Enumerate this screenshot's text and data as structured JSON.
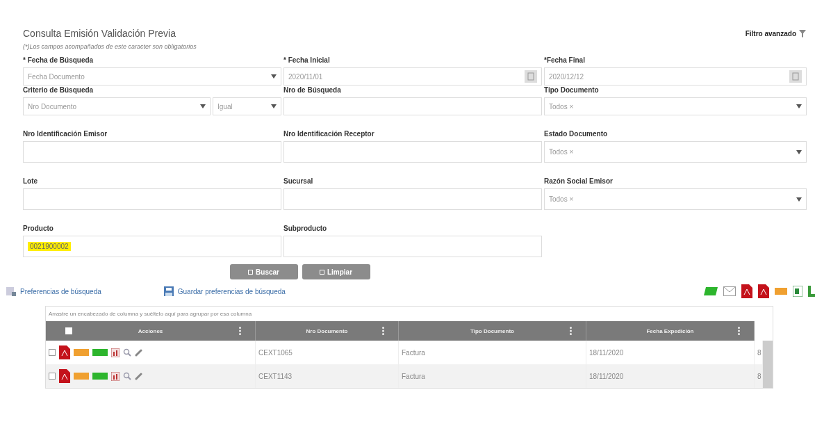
{
  "header": {
    "title": "Consulta Emisión Validación Previa",
    "note": "(*)Los campos acompañados de este caracter son obligatorios",
    "advanced_filter": "Filtro avanzado"
  },
  "field_rows": [
    [
      {
        "label": "* Fecha de Búsqueda",
        "kind": "select",
        "value": "Fecha Documento"
      },
      {
        "label": "* Fecha Inicial",
        "kind": "date",
        "value": "2020/11/01"
      },
      {
        "label": "*Fecha Final",
        "kind": "date",
        "value": "2020/12/12"
      }
    ],
    [
      {
        "label": "Criterio de Búsqueda",
        "kind": "dual_select",
        "values": [
          "Nro Documento",
          "Igual"
        ]
      },
      {
        "label": "Nro de Búsqueda",
        "kind": "text"
      },
      {
        "label": "Tipo Documento",
        "kind": "multiselect",
        "tag": "Todos ×"
      }
    ],
    [
      {
        "label": "Nro Identificación Emisor",
        "kind": "text"
      },
      {
        "label": "Nro Identificación Receptor",
        "kind": "text"
      },
      {
        "label": "Estado Documento",
        "kind": "multiselect",
        "tag": "Todos ×"
      }
    ],
    [
      {
        "label": "Lote",
        "kind": "text"
      },
      {
        "label": "Sucursal",
        "kind": "text"
      },
      {
        "label": "Razón Social Emisor",
        "kind": "multiselect",
        "tag": "Todos ×"
      }
    ],
    [
      {
        "label": "Producto",
        "kind": "text",
        "value": "0021900002",
        "highlighted": true
      },
      {
        "label": "Subproducto",
        "kind": "text"
      }
    ]
  ],
  "buttons": [
    "Buscar",
    "Limpiar"
  ],
  "links": [
    "Preferencias de búsqueda",
    "Guardar preferencias de búsqueda"
  ],
  "table": {
    "group_hint": "Arrastre un encabezado de columna y suéltelo aquí para agrupar por esa columna",
    "header_checked": false,
    "columns": [
      "Acciones",
      "Nro Documento",
      "Tipo Documento",
      "Fecha Expedición"
    ],
    "rows": [
      {
        "checked": false,
        "cells": [
          "CEXT1065",
          "Factura",
          "18/11/2020",
          "8"
        ]
      },
      {
        "checked": false,
        "cells": [
          "CEXT1143",
          "Factura",
          "18/11/2020",
          "8"
        ]
      }
    ]
  }
}
